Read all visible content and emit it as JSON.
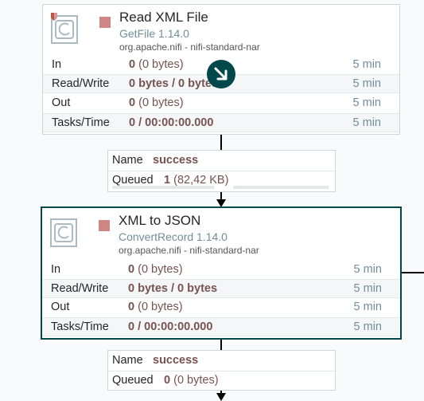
{
  "processor1": {
    "name": "Read XML File",
    "type": "GetFile 1.14.0",
    "bundle": "org.apache.nifi - nifi-standard-nar",
    "stats": [
      {
        "label": "In",
        "value": "0",
        "extra": "(0 bytes)",
        "time": "5 min"
      },
      {
        "label": "Read/Write",
        "value": "0 bytes / 0 bytes",
        "extra": "",
        "time": "5 min"
      },
      {
        "label": "Out",
        "value": "0",
        "extra": "(0 bytes)",
        "time": "5 min"
      },
      {
        "label": "Tasks/Time",
        "value": "0 / 00:00:00.000",
        "extra": "",
        "time": "5 min"
      }
    ]
  },
  "connection1": {
    "name_label": "Name",
    "name_value": "success",
    "queued_label": "Queued",
    "queued_count": "1",
    "queued_size": "(82,42 KB)"
  },
  "processor2": {
    "name": "XML to JSON",
    "type": "ConvertRecord 1.14.0",
    "bundle": "org.apache.nifi - nifi-standard-nar",
    "stats": [
      {
        "label": "In",
        "value": "0",
        "extra": "(0 bytes)",
        "time": "5 min"
      },
      {
        "label": "Read/Write",
        "value": "0 bytes / 0 bytes",
        "extra": "",
        "time": "5 min"
      },
      {
        "label": "Out",
        "value": "0",
        "extra": "(0 bytes)",
        "time": "5 min"
      },
      {
        "label": "Tasks/Time",
        "value": "0 / 00:00:00.000",
        "extra": "",
        "time": "5 min"
      }
    ]
  },
  "connection2": {
    "name_label": "Name",
    "name_value": "success",
    "queued_label": "Queued",
    "queued_count": "0",
    "queued_size": "(0 bytes)"
  },
  "colors": {
    "accent": "#004849",
    "stopped": "#d18686",
    "value_text": "#775351",
    "muted": "#728e9b",
    "restricted_badge": "#ba554a"
  },
  "icons": {
    "processor": "processor-icon",
    "restricted": "restricted-shield-icon",
    "stopped": "stopped-square-icon",
    "birdseye": "navigate-arrow-icon"
  }
}
